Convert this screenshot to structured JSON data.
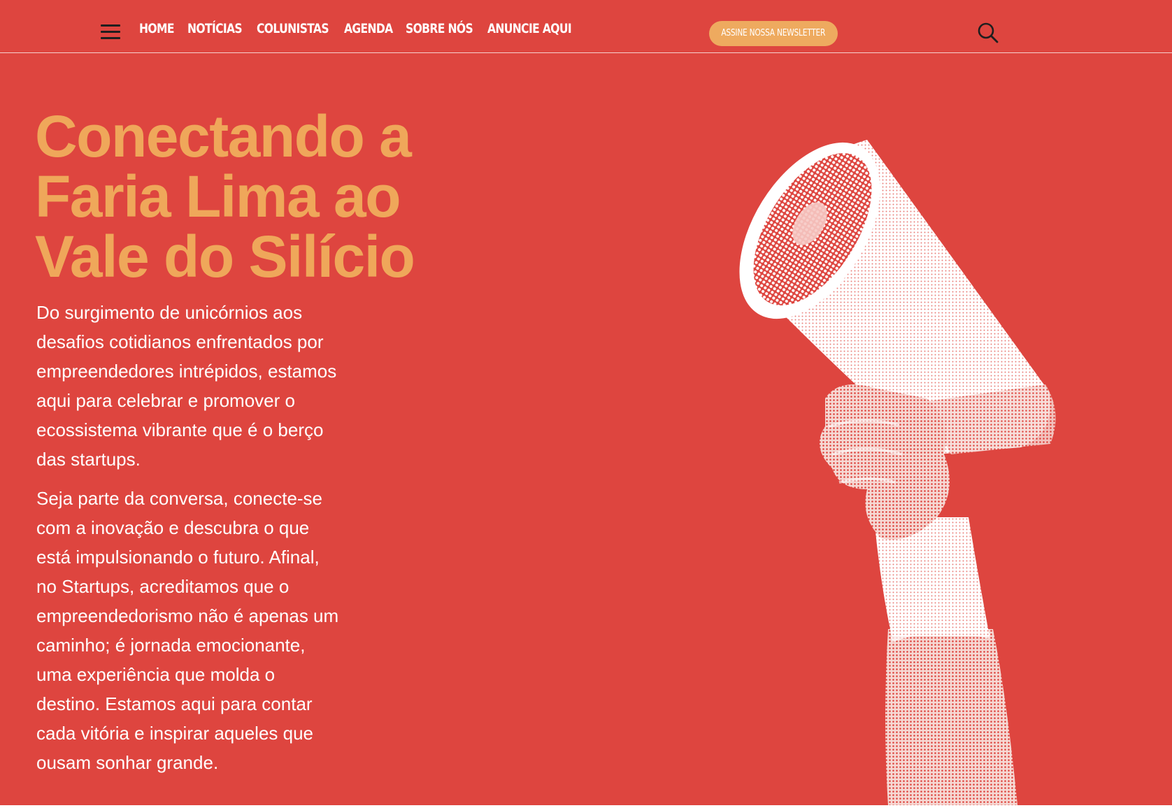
{
  "header": {
    "menu_icon": "hamburger-menu-icon",
    "nav": [
      {
        "label": "HOME"
      },
      {
        "label": "NOTÍCIAS"
      },
      {
        "label": "COLUNISTAS"
      },
      {
        "label": "AGENDA"
      },
      {
        "label": "SOBRE NÓS"
      },
      {
        "label": "ANUNCIE AQUI"
      }
    ],
    "newsletter_label": "ASSINE NOSSA NEWSLETTER",
    "search_icon": "search-icon"
  },
  "hero": {
    "title_lines": [
      "Conectando a",
      "Faria Lima ao",
      "Vale do Silício"
    ],
    "paragraph1_lines": [
      "Do surgimento de unicórnios aos",
      "desafios cotidianos enfrentados por",
      "empreendedores intrépidos, estamos",
      "aqui para celebrar e promover o",
      "ecossistema vibrante que é o berço",
      "das startups."
    ],
    "paragraph2_lines": [
      "Seja parte da conversa, conecte-se",
      "com a inovação e descubra o que",
      "está impulsionando o futuro. Afinal,",
      "no Startups, acreditamos que o",
      "empreendedorismo não é apenas um",
      "caminho; é jornada emocionante,",
      "uma experiência que molda o",
      "destino. Estamos aqui para contar",
      "cada vitória e inspirar aqueles que",
      "ousam sonhar grande."
    ],
    "illustration": "hand-holding-megaphone-illustration"
  },
  "colors": {
    "background": "#de453f",
    "title": "#efa75a",
    "button": "#eeaa5f",
    "text": "#ffffff"
  }
}
